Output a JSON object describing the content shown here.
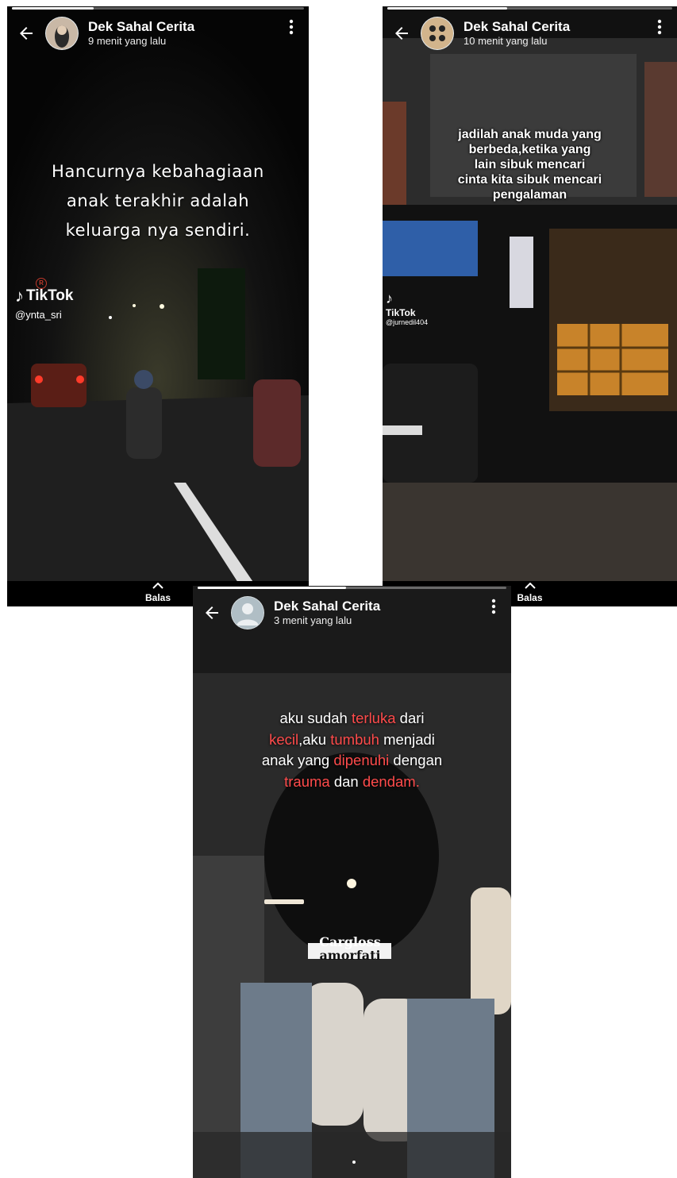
{
  "stories": [
    {
      "user_name": "Dek Sahal Cerita",
      "time": "9 menit yang lalu",
      "caption_lines": [
        "Hancurnya kebahagiaan",
        "anak terakhir adalah",
        "keluarga nya sendiri."
      ],
      "watermark": {
        "brand": "TikTok",
        "handle": "@ynta_sri"
      },
      "reply_label": "Balas",
      "progress": 0.28
    },
    {
      "user_name": "Dek Sahal Cerita",
      "time": "10 menit yang lalu",
      "caption_lines": [
        "jadilah anak muda yang",
        "berbeda,ketika yang",
        "lain sibuk mencari",
        "cinta kita sibuk mencari",
        "pengalaman"
      ],
      "watermark": {
        "brand": "TikTok",
        "handle": "@jurnedil404"
      },
      "reply_label": "Balas",
      "progress": 0.42
    },
    {
      "user_name": "Dek Sahal Cerita",
      "time": "3 menit yang lalu",
      "caption": {
        "l1_a": "aku sudah ",
        "l1_b": "terluka",
        "l1_c": " dari",
        "l2_a": "kecil",
        "l2_b": ",aku ",
        "l2_c": "tumbuh",
        "l2_d": " menjadi",
        "l3_a": "anak yang ",
        "l3_b": "dipenuhi",
        "l3_c": " dengan",
        "l4_a": "trauma",
        "l4_b": " dan ",
        "l4_c": "dendam."
      },
      "helmet_text": [
        "Cargloss",
        "amorfati"
      ],
      "progress": 0.48
    }
  ],
  "colors": {
    "highlight": "#ff4b4b",
    "story_bg": "#000000"
  }
}
